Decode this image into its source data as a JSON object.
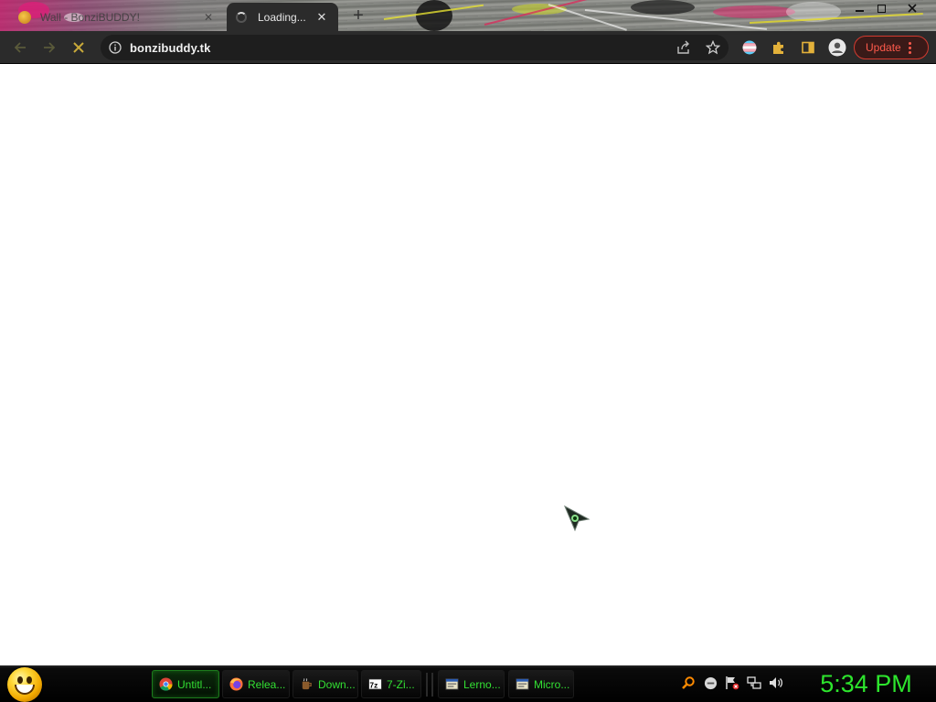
{
  "tabs": [
    {
      "title": "Wall - BonziBUDDY!",
      "close_label": "✕",
      "state": "inactive"
    },
    {
      "title": "Loading...",
      "close_label": "✕",
      "state": "loading"
    }
  ],
  "new_tab_label": "+",
  "toolbar": {
    "url": "bonzibuddy.tk",
    "update_label": "Update",
    "reload_state": "stop"
  },
  "taskbar": {
    "items": [
      {
        "label": "Untitl...",
        "icon": "chrome-icon",
        "active": true
      },
      {
        "label": "Relea...",
        "icon": "firefox-icon",
        "active": false
      },
      {
        "label": "Down...",
        "icon": "coffee-cup-icon",
        "active": false
      },
      {
        "label": "7-Zi...",
        "icon": "7zip-icon",
        "active": false
      },
      {
        "label": "Lerno...",
        "icon": "app-window-icon",
        "active": false
      },
      {
        "label": "Micro...",
        "icon": "app-window-icon",
        "active": false
      }
    ],
    "clock": "5:34 PM"
  },
  "colors": {
    "toolbar": "#2b2b2b",
    "update_accent": "#ff5a4c",
    "taskbar_text": "#33e033",
    "clock": "#2de52d"
  }
}
